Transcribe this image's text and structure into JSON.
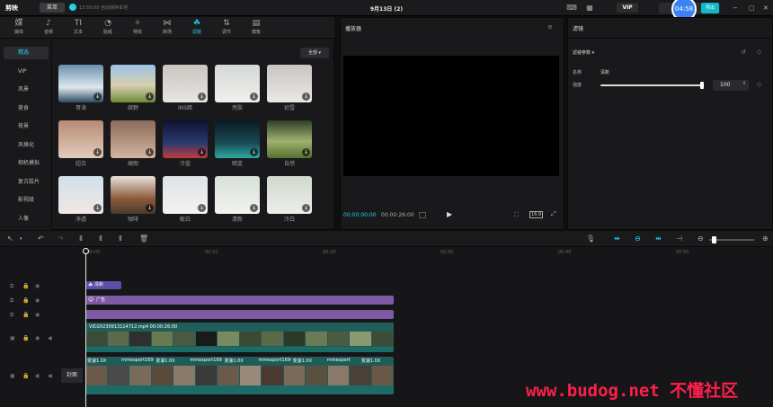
{
  "topbar": {
    "logo": "剪映",
    "menu_label": "菜单",
    "autosave": "13:55:05 自动保存本地",
    "title": "9月13日 (2)",
    "vip_label": "VIP",
    "export_label": "导出",
    "timer": "04:58"
  },
  "tabs": [
    {
      "icon": "媒",
      "label": "媒体"
    },
    {
      "icon": "♪",
      "label": "音频"
    },
    {
      "icon": "TI",
      "label": "文本"
    },
    {
      "icon": "◔",
      "label": "贴纸"
    },
    {
      "icon": "✧",
      "label": "特效"
    },
    {
      "icon": "⋈",
      "label": "转场"
    },
    {
      "icon": "☘",
      "label": "滤镜"
    },
    {
      "icon": "⇅",
      "label": "调节"
    },
    {
      "icon": "▤",
      "label": "模板"
    }
  ],
  "active_tab": "滤镜",
  "sidebar": [
    "精选",
    "VIP",
    "风景",
    "美食",
    "夜景",
    "风格化",
    "相机模拟",
    "复古胶片",
    "影视级",
    "人像"
  ],
  "all_label": "全部",
  "filters": [
    [
      "哥涛",
      "缤野",
      "INS暗",
      "亮肤",
      "初雪"
    ],
    [
      "超白",
      "硬朗",
      "冷蓝",
      "暗蓝",
      "自然"
    ],
    [
      "净透",
      "咖啡",
      "敏白",
      "清新",
      "冷白"
    ]
  ],
  "player": {
    "title": "播放器",
    "current_time": "00:00:00:00",
    "total_time": "00:00:26:00",
    "ratio": "16:9"
  },
  "properties": {
    "title": "滤镜",
    "section": "滤镜参数",
    "name_label": "名称",
    "name_value": "清新",
    "strength_label": "强度",
    "strength_value": "100",
    "strength_level": 1.0
  },
  "timeline": {
    "ticks": [
      "00:00",
      "00:10",
      "00:20",
      "00:30",
      "00:40",
      "00:50"
    ],
    "filter_clip": "清新",
    "ad_clip": "广告",
    "video_clip": "VID20230913114712.mp4  00:00:26:00",
    "bottom_clips": [
      "变速1.0X",
      "mmexport16945",
      "变速1.0X",
      "mmexport1694579",
      "变速1.0X",
      "mmexport16945",
      "变速1.0X",
      "mmexport",
      "变速1.0X"
    ],
    "cover_label": "封面"
  },
  "watermark": "www.budog.net 不懂社区"
}
